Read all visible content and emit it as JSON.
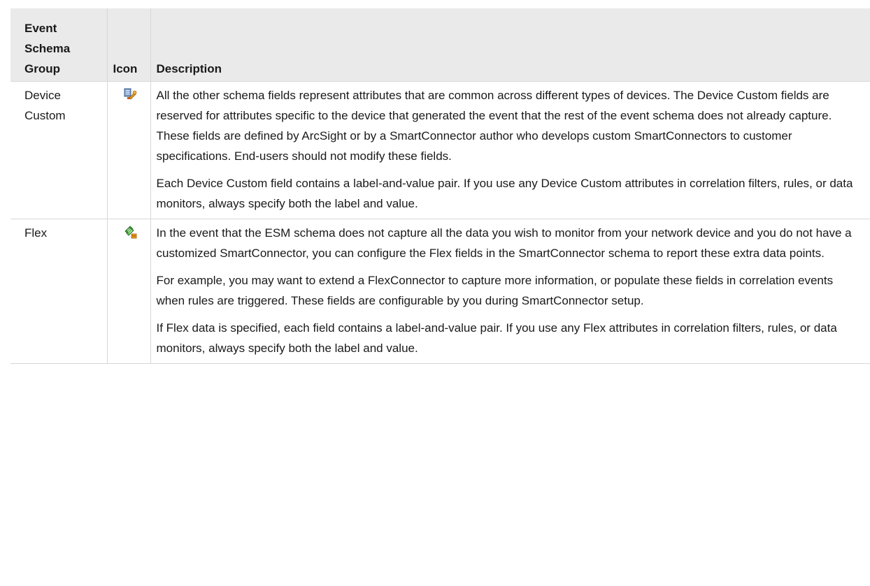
{
  "table": {
    "headers": {
      "group": "Event Schema Group",
      "icon": "Icon",
      "description": "Description"
    },
    "rows": [
      {
        "group": "Device Custom",
        "icon": "device-custom-icon",
        "paragraphs": [
          "All the other schema fields represent attributes that are common across different types of devices. The Device Custom fields are reserved for attributes specific to the device that generated the event that the rest of the event schema does not already capture. These fields are defined by ArcSight or by a SmartConnector author who develops custom SmartConnectors to customer specifications. End-users should not modify these fields.",
          "Each Device Custom field contains a label-and-value pair. If you use any Device Custom attributes in correlation filters, rules, or data monitors, always specify both the label and value."
        ]
      },
      {
        "group": "Flex",
        "icon": "flex-icon",
        "paragraphs": [
          "In the event that the ESM schema does not capture all the data you wish to monitor from your network device and you do not have a customized SmartConnector, you can configure the Flex fields in the SmartConnector schema to report these extra data points.",
          "For example, you may want to extend a FlexConnector to capture more information, or populate these fields in correlation events when rules are triggered. These fields are configurable by you during SmartConnector setup.",
          "If Flex data is specified, each field contains a label-and-value pair. If you use any Flex attributes in correlation filters, rules, or data monitors, always specify both the label and value."
        ]
      }
    ]
  }
}
